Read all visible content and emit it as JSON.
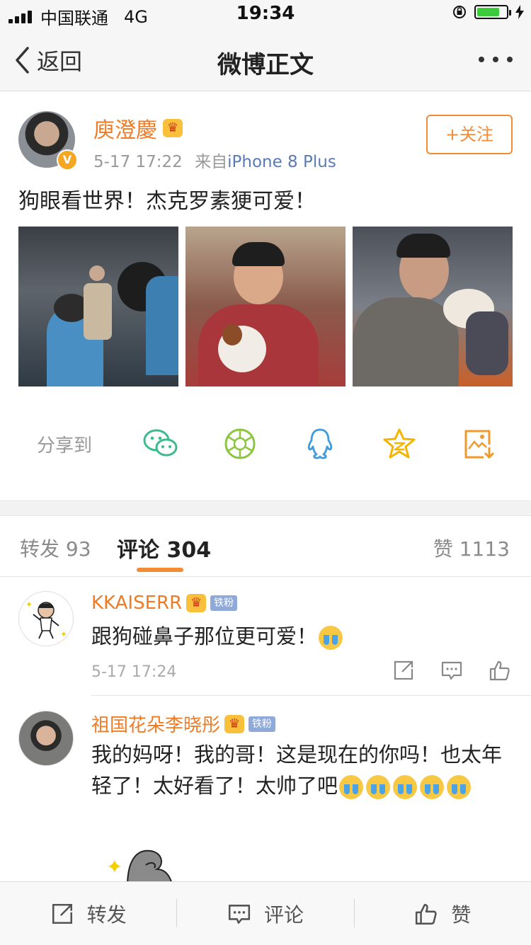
{
  "status": {
    "carrier": "中国联通",
    "network": "4G",
    "time": "19:34"
  },
  "nav": {
    "back_label": "返回",
    "title": "微博正文"
  },
  "post": {
    "author": "庾澄慶",
    "timestamp": "5-17 17:22",
    "source_prefix": "来自",
    "source": "iPhone 8 Plus",
    "follow_label": "+关注",
    "text": "狗眼看世界！杰克罗素㹴可爱！",
    "share_label": "分享到",
    "share_icons": [
      "wechat-icon",
      "moments-icon",
      "qq-icon",
      "qzone-icon",
      "save-image-icon"
    ]
  },
  "tabs": {
    "repost": "转发 93",
    "comments": "评论 304",
    "likes": "赞 1113"
  },
  "comments": [
    {
      "name": "KKAISERR",
      "badge": "铁粉",
      "text": "跟狗碰鼻子那位更可爱！",
      "emoji_count": 1,
      "time": "5-17 17:24"
    },
    {
      "name": "祖国花朵李晓彤",
      "badge": "铁粉",
      "text": "我的妈呀！我的哥！这是现在的你吗！也太年轻了！太好看了！太帅了吧",
      "emoji_count": 5
    }
  ],
  "bottom_bar": {
    "repost": "转发",
    "comment": "评论",
    "like": "赞"
  },
  "colors": {
    "accent": "#f28c35",
    "name": "#f07b25",
    "link": "#5b7bb5"
  }
}
